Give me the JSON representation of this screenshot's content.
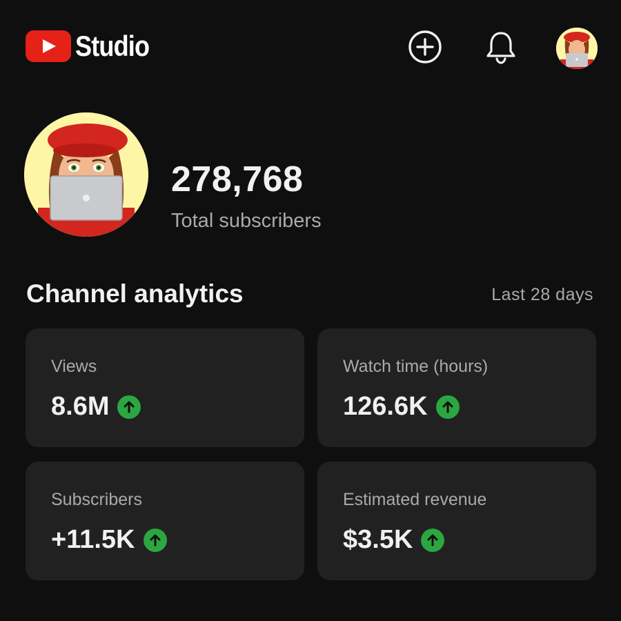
{
  "header": {
    "logo_text": "Studio",
    "create_icon": "create-plus-icon",
    "notifications_icon": "bell-icon"
  },
  "channel": {
    "subscriber_count": "278,768",
    "subscriber_label": "Total subscribers"
  },
  "analytics": {
    "title": "Channel analytics",
    "range": "Last 28 days",
    "cards": [
      {
        "label": "Views",
        "value": "8.6M",
        "trend": "up"
      },
      {
        "label": "Watch time (hours)",
        "value": "126.6K",
        "trend": "up"
      },
      {
        "label": "Subscribers",
        "value": "+11.5K",
        "trend": "up"
      },
      {
        "label": "Estimated revenue",
        "value": "$3.5K",
        "trend": "up"
      }
    ]
  },
  "colors": {
    "background": "#0f0f0f",
    "card": "#212121",
    "brand_red": "#e62117",
    "trend_up": "#2ba640",
    "avatar_bg": "#fdf6a7"
  }
}
